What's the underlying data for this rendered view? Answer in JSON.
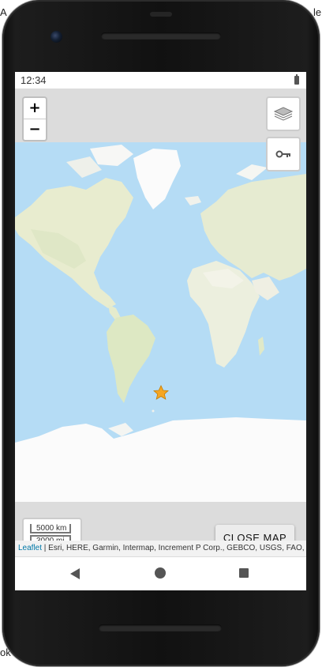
{
  "status_bar": {
    "time": "12:34"
  },
  "map_controls": {
    "zoom_in": "+",
    "zoom_out": "−",
    "layers_icon": "layers-icon",
    "key_icon": "key-icon"
  },
  "scale": {
    "metric": "5000 km",
    "imperial": "3000 mi"
  },
  "marker": {
    "icon": "star-icon",
    "color": "#f5a623"
  },
  "close_map_button": "CLOSE MAP",
  "attribution": {
    "leaflet": "Leaflet",
    "sources": " | Esri, HERE, Garmin, Intermap, Increment P Corp., GEBCO, USGS, FAO, NP..."
  },
  "nav_bar": {
    "back": "back-icon",
    "home": "home-icon",
    "recent": "recent-apps-icon"
  },
  "colors": {
    "ocean": "#b5dcf5",
    "land": "#e9ecd9",
    "ice": "#fbfbfb",
    "accent": "#0078a8"
  }
}
